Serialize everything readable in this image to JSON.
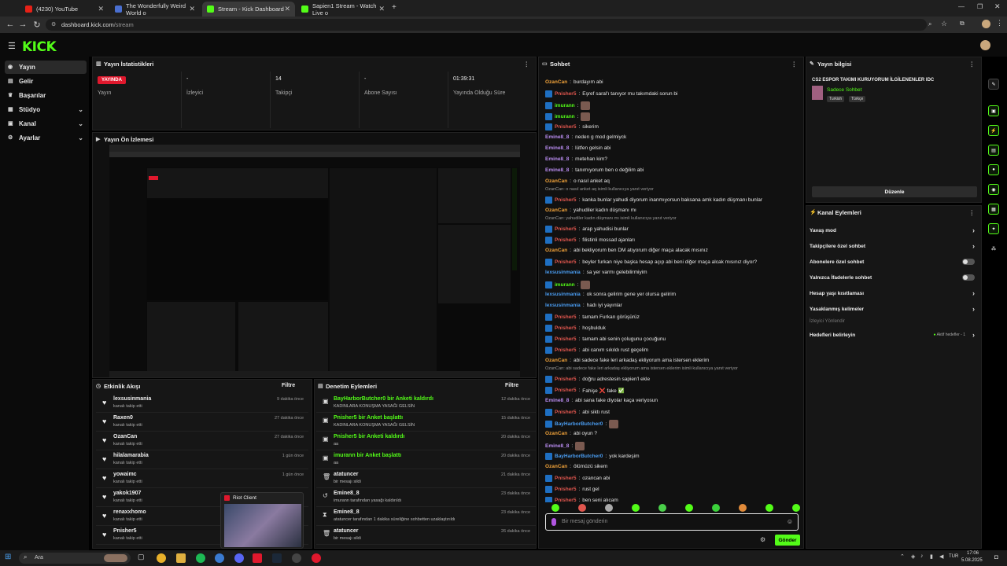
{
  "browser": {
    "tabs": [
      {
        "label": "(4230) YouTube",
        "color": "#e62117"
      },
      {
        "label": "The Wonderfully Weird World o",
        "color": "#4a6fd0"
      },
      {
        "label": "Stream - Kick Dashboard",
        "color": "#53fc18"
      },
      {
        "label": "Sapien1 Stream - Watch Live o",
        "color": "#53fc18"
      }
    ],
    "url_host": "dashboard.kick.com",
    "url_path": "/stream"
  },
  "app": {
    "logo": "KICK"
  },
  "sidebar": {
    "items": [
      {
        "label": "Yayın",
        "icon": "broadcast-icon"
      },
      {
        "label": "Gelir",
        "icon": "money-icon"
      },
      {
        "label": "Başarılar",
        "icon": "trophy-icon"
      },
      {
        "label": "Stüdyo",
        "icon": "studio-icon"
      },
      {
        "label": "Kanal",
        "icon": "channel-icon"
      },
      {
        "label": "Ayarlar",
        "icon": "settings-icon"
      }
    ]
  },
  "stats": {
    "title": "Yayın İstatistikleri",
    "live_badge": "YAYINDA",
    "cells": [
      {
        "value": "",
        "label": "Yayın"
      },
      {
        "value": "-",
        "label": "İzleyici"
      },
      {
        "value": "14",
        "label": "Takipçi"
      },
      {
        "value": "-",
        "label": "Abone Sayısı"
      },
      {
        "value": "01:39:31",
        "label": "Yayında Olduğu Süre"
      }
    ]
  },
  "preview": {
    "title": "Yayın Ön İzlemesi"
  },
  "activity": {
    "title": "Etkinlik Akışı",
    "filter": "Filtre",
    "items": [
      {
        "name": "lexsusinmania",
        "sub": "kanalı takip etti",
        "time": "9 dakika önce"
      },
      {
        "name": "Raxen0",
        "sub": "kanalı takip etti",
        "time": "27 dakika önce"
      },
      {
        "name": "OzanCan",
        "sub": "kanalı takip etti",
        "time": "27 dakika önce"
      },
      {
        "name": "hilalamarabia",
        "sub": "kanalı takip etti",
        "time": "1 gün önce"
      },
      {
        "name": "yowaimc",
        "sub": "kanalı takip etti",
        "time": "1 gün önce"
      },
      {
        "name": "yakok1907",
        "sub": "kanalı takip etti",
        "time": ""
      },
      {
        "name": "renaxxhomo",
        "sub": "kanalı takip etti",
        "time": ""
      },
      {
        "name": "Pnisher5",
        "sub": "kanalı takip etti",
        "time": ""
      }
    ]
  },
  "moderation": {
    "title": "Denetim Eylemleri",
    "filter": "Filtre",
    "items": [
      {
        "name": "BayHarborButcher0 bir Anketi kaldırdı",
        "sub": "KADINLARA KONUŞMA YASAĞI GELSİN",
        "time": "12 dakika önce",
        "color": "#53fc18"
      },
      {
        "name": "Pnisher5 bir Anket başlattı",
        "sub": "KADINLARA KONUŞMA YASAĞI GELSİN",
        "time": "15 dakika önce",
        "color": "#53fc18"
      },
      {
        "name": "Pnisher5 bir Anketi kaldırdı",
        "sub": "aa",
        "time": "20 dakika önce",
        "color": "#53fc18"
      },
      {
        "name": "imurann bir Anket başlattı",
        "sub": "aa",
        "time": "20 dakika önce",
        "color": "#53fc18"
      },
      {
        "name": "atatuncer",
        "sub": "bir mesajı sildi",
        "time": "21 dakika önce",
        "color": "#eeeeee"
      },
      {
        "name": "Emine8_8",
        "sub": "imurann tarafından yasağı kaldırıldı",
        "time": "23 dakika önce",
        "color": "#eeeeee"
      },
      {
        "name": "Emine8_8",
        "sub": "atatuncer tarafından 1 dakika süreliğine sohbetten uzaklaştırıldı",
        "time": "23 dakika önce",
        "color": "#eeeeee"
      },
      {
        "name": "atatuncer",
        "sub": "bir mesajı sildi",
        "time": "26 dakika önce",
        "color": "#eeeeee"
      }
    ]
  },
  "chat": {
    "title": "Sohbet",
    "input_placeholder": "Bir mesaj gönderin",
    "send_label": "Gönder",
    "messages": [
      {
        "user": "OzanCan",
        "text": "burdayım abi",
        "color": "#f0a23a",
        "badge": false,
        "emote": false
      },
      {
        "user": "Pnisher5",
        "text": "Eşref saral'ı tanıyor mu takımdaki sorun bi",
        "color": "#e0564e",
        "badge": true,
        "emote": false
      },
      {
        "user": "imurann",
        "text": "",
        "color": "#53fc18",
        "badge": true,
        "emote": true
      },
      {
        "user": "imurann",
        "text": "",
        "color": "#53fc18",
        "badge": true,
        "emote": true
      },
      {
        "user": "Pnisher5",
        "text": "sikerim",
        "color": "#e0564e",
        "badge": true,
        "emote": false
      },
      {
        "user": "Emine8_8",
        "text": "neden g mod gelmiyck",
        "color": "#b98cf0",
        "badge": false,
        "emote": false
      },
      {
        "user": "Emine8_8",
        "text": "lütfen gelsin abi",
        "color": "#b98cf0",
        "badge": false,
        "emote": false
      },
      {
        "user": "Emine8_8",
        "text": "metehan kim?",
        "color": "#b98cf0",
        "badge": false,
        "emote": false
      },
      {
        "user": "Emine8_8",
        "text": "tanımıyorum ben o değilim abi",
        "color": "#b98cf0",
        "badge": false,
        "emote": false
      },
      {
        "user": "OzanCan",
        "text": "o nasıl anket aq",
        "color": "#f0a23a",
        "badge": false,
        "emote": false
      },
      {
        "reply": "OzanCan: o nasıl anket aq isimli kullanıcıya yanıt veriyor"
      },
      {
        "user": "Pnisher5",
        "text": "kanka bunlar yahudi diyorum inanmıyorsun baksana amk kadın düşmanı bunlar",
        "color": "#e0564e",
        "badge": true,
        "emote": false
      },
      {
        "user": "OzanCan",
        "text": "yahudiler kadın düşmanı mı",
        "color": "#f0a23a",
        "badge": false,
        "emote": false
      },
      {
        "reply": "OzanCan: yahudiler kadın düşmanı mı isimli kullanıcıya yanıt veriyor"
      },
      {
        "user": "Pnisher5",
        "text": "arap yahudisi bunlar",
        "color": "#e0564e",
        "badge": true,
        "emote": false
      },
      {
        "user": "Pnisher5",
        "text": "filistinli mossad ajanları",
        "color": "#e0564e",
        "badge": true,
        "emote": false
      },
      {
        "user": "OzanCan",
        "text": "abi bekliyorum ben DM atıyorum diğer maça alacak mısınız",
        "color": "#f0a23a",
        "badge": false,
        "emote": false
      },
      {
        "user": "Pnisher5",
        "text": "beyler furkan niye başka hesap açıp abi beni diğer maça alcak mısınız diyor?",
        "color": "#e0564e",
        "badge": true,
        "emote": false
      },
      {
        "user": "lexsusinmania",
        "text": "sa yer varmı gelebilirmiyim",
        "color": "#4a9cf0",
        "badge": false,
        "emote": false
      },
      {
        "user": "imurann",
        "text": "",
        "color": "#53fc18",
        "badge": true,
        "emote": true
      },
      {
        "user": "lexsusinmania",
        "text": "ok sonra gelirim gene yer olursa gelirim",
        "color": "#4a9cf0",
        "badge": false,
        "emote": false
      },
      {
        "user": "lexsusinmania",
        "text": "hadı iyi yayınlar",
        "color": "#4a9cf0",
        "badge": false,
        "emote": false
      },
      {
        "user": "Pnisher5",
        "text": "tamam Furkan görüşürüz",
        "color": "#e0564e",
        "badge": true,
        "emote": false
      },
      {
        "user": "Pnisher5",
        "text": "hoşbulduk",
        "color": "#e0564e",
        "badge": true,
        "emote": false
      },
      {
        "user": "Pnisher5",
        "text": "tamam abi senin çolugunu çocuğunu",
        "color": "#e0564e",
        "badge": true,
        "emote": false
      },
      {
        "user": "Pnisher5",
        "text": "abi canım sıkıldı rust geçelim",
        "color": "#e0564e",
        "badge": true,
        "emote": false
      },
      {
        "user": "OzanCan",
        "text": "abi sadece fake leri arkadaş ekliyorum ama istersen eklerim",
        "color": "#f0a23a",
        "badge": false,
        "emote": false
      },
      {
        "reply": "OzanCan: abi sadece fake leri arkadaş ekliyorum ama istersen eklerim isimli kullanıcıya yanıt veriyor"
      },
      {
        "user": "Pnisher5",
        "text": "doğru adrestesin sapien'l ekle",
        "color": "#e0564e",
        "badge": true,
        "emote": false
      },
      {
        "user": "Pnisher5",
        "text": "Fahişe ❌ fake ✅",
        "color": "#e0564e",
        "badge": true,
        "emote": false
      },
      {
        "user": "Emine8_8",
        "text": "abi sana fake diyolar kaça veriyosun",
        "color": "#b98cf0",
        "badge": false,
        "emote": false
      },
      {
        "user": "Pnisher5",
        "text": "abi siktı rust",
        "color": "#e0564e",
        "badge": true,
        "emote": false
      },
      {
        "user": "BayHarborButcher0",
        "text": "",
        "color": "#4a9cf0",
        "badge": true,
        "emote": true
      },
      {
        "user": "OzanCan",
        "text": "abi oyun ?",
        "color": "#f0a23a",
        "badge": false,
        "emote": false
      },
      {
        "user": "Emine8_8",
        "text": "",
        "color": "#b98cf0",
        "badge": false,
        "emote": true
      },
      {
        "user": "BayHarborButcher0",
        "text": "yok kardeşim",
        "color": "#4a9cf0",
        "badge": true,
        "emote": false
      },
      {
        "user": "OzanCan",
        "text": "ölümüzü sikem",
        "color": "#f0a23a",
        "badge": false,
        "emote": false
      },
      {
        "user": "Pnisher5",
        "text": "ozancan abi",
        "color": "#e0564e",
        "badge": true,
        "emote": false
      },
      {
        "user": "Pnisher5",
        "text": "rust gel",
        "color": "#e0564e",
        "badge": true,
        "emote": false
      },
      {
        "user": "Pnisher5",
        "text": "ben seni alıcam",
        "color": "#e0564e",
        "badge": true,
        "emote": false
      }
    ]
  },
  "streaminfo": {
    "title": "Yayın bilgisi",
    "stream_title": "CS2 ESPOR TAKIMI KURUYORUM İLGİLENENLER IDC",
    "category": "Sadece Sohbet",
    "tags": [
      "Turkish",
      "Türkçe"
    ],
    "edit_label": "Düzenle"
  },
  "channel_actions": {
    "title": "Kanal Eylemleri",
    "items": [
      {
        "label": "Yavaş mod",
        "control": "chevron"
      },
      {
        "label": "Takipçilere özel sohbet",
        "control": "chevron"
      },
      {
        "label": "Abonelere özel sohbet",
        "control": "toggle"
      },
      {
        "label": "Yalnızca İfadelerle sohbet",
        "control": "toggle"
      },
      {
        "label": "Hesap yaşı kısıtlaması",
        "control": "chevron"
      },
      {
        "label": "Yasaklanmış kelimeler",
        "control": "chevron"
      }
    ],
    "viewer_mod": "İzleyici Yönlendir",
    "goals_label": "Hedefleri belirleyin",
    "goals_status": "Aktif hedefler - 1"
  },
  "taskbar": {
    "search": "Ara",
    "riot_label": "Riot Client",
    "lang": "TUR",
    "time": "17:06",
    "date": "5.08.2025"
  },
  "colors": {
    "kick_green": "#53fc18",
    "live_red": "#e0182d"
  }
}
